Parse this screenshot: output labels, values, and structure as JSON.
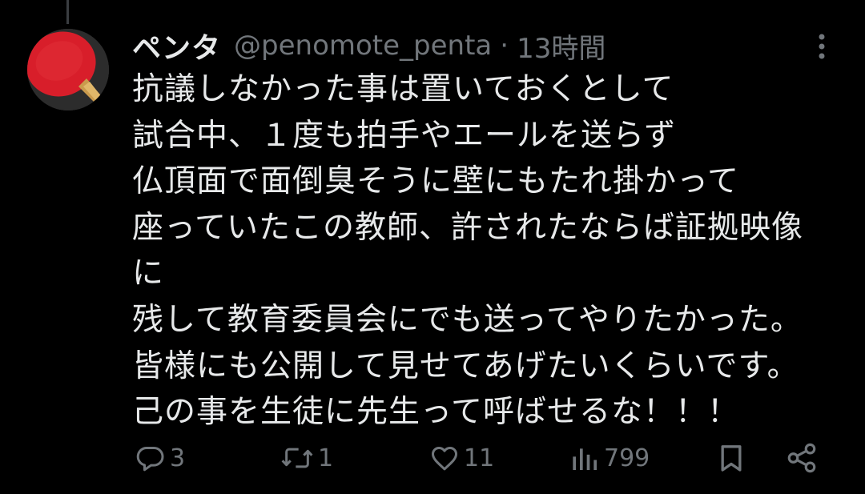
{
  "tweet": {
    "display_name": "ペンタ",
    "handle": "@penomote_penta",
    "separator": "·",
    "time": "13時間",
    "lines": [
      "抗議しなかった事は置いておくとして",
      "試合中、１度も拍手やエールを送らず",
      "仏頂面で面倒臭そうに壁にもたれ掛かって",
      "座っていたこの教師、許されたならば証拠映像",
      "に",
      "残して教育委員会にでも送ってやりたかった。",
      "皆様にも公開して見せてあげたいくらいです。",
      "己の事を生徒に先生って呼ばせるな！！！"
    ]
  },
  "actions": {
    "reply_count": "3",
    "retweet_count": "1",
    "like_count": "11",
    "view_count": "799"
  },
  "icons": {
    "reply": "reply-icon",
    "retweet": "retweet-icon",
    "like": "heart-icon",
    "views": "views-icon",
    "bookmark": "bookmark-icon",
    "share": "share-icon",
    "more": "more-vertical-icon"
  },
  "colors": {
    "background": "#000000",
    "text": "#e7e9ea",
    "secondary": "#71767b",
    "avatar_red": "#d81e2a"
  }
}
